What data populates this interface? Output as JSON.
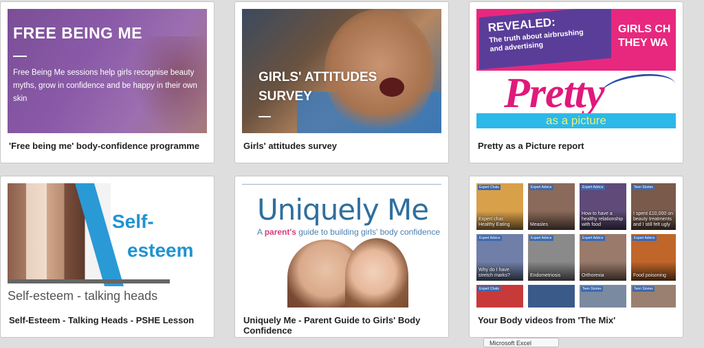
{
  "cards": [
    {
      "caption": "'Free being me' body-confidence programme",
      "thumb": {
        "title": "FREE BEING ME",
        "description": "Free Being Me sessions help girls recognise beauty myths, grow in confidence and be happy in their own skin"
      }
    },
    {
      "caption": "Girls' attitudes survey",
      "thumb": {
        "title_line1": "GIRLS' ATTITUDES",
        "title_line2": "SURVEY"
      }
    },
    {
      "caption": "Pretty as a Picture report",
      "thumb": {
        "revealed": "REVEALED:",
        "revealed_sub1": "The truth about airbrushing",
        "revealed_sub2": "and advertising",
        "girls_line1": "GIRLS CH",
        "girls_line2": "THEY WA",
        "pretty": "Pretty",
        "as_a_picture": "as a picture"
      }
    },
    {
      "caption": "Self-Esteem - Talking Heads - PSHE Lesson",
      "thumb": {
        "word1": "Self-",
        "word2": "esteem",
        "subtitle": "Self-esteem - talking heads"
      }
    },
    {
      "caption": "Uniquely Me - Parent Guide to Girls' Body Confidence",
      "thumb": {
        "title": "Uniquely Me",
        "sub_prefix": "A",
        "sub_bold": "parent's",
        "sub_rest": "guide to building girls' body confidence"
      }
    },
    {
      "caption": "Your Body videos from 'The Mix'",
      "tiles": [
        {
          "tag": "Expert Chats",
          "title": "Expert chat: Healthy Eating",
          "color": "#d9a04a"
        },
        {
          "tag": "Expert Advice",
          "title": "Measles",
          "color": "#8a6a5a"
        },
        {
          "tag": "Expert Advice",
          "title": "How to have a healthy relationship with food",
          "color": "#5f4a7a"
        },
        {
          "tag": "Teen Stories",
          "title": "I spent £10,000 on beauty treatments and I still felt ugly",
          "color": "#7a5a4a"
        },
        {
          "tag": "Expert Advice",
          "title": "Why do I have stretch marks?",
          "color": "#6f7fa8"
        },
        {
          "tag": "Expert Advice",
          "title": "Endometriosis",
          "color": "#8a8a8a"
        },
        {
          "tag": "Expert Advice",
          "title": "Orthorexia",
          "color": "#9a7a6a"
        },
        {
          "tag": "Expert Advice",
          "title": "Food poisoning",
          "color": "#c0662a"
        },
        {
          "tag": "Expert Chats",
          "title": "",
          "color": "#c8393a"
        },
        {
          "tag": "",
          "title": "",
          "color": "#3a5a8a"
        },
        {
          "tag": "Teen Stories",
          "title": "",
          "color": "#7a8aa0"
        },
        {
          "tag": "Teen Stories",
          "title": "",
          "color": "#9a8070"
        }
      ]
    }
  ],
  "tooltip": "Microsoft Excel"
}
